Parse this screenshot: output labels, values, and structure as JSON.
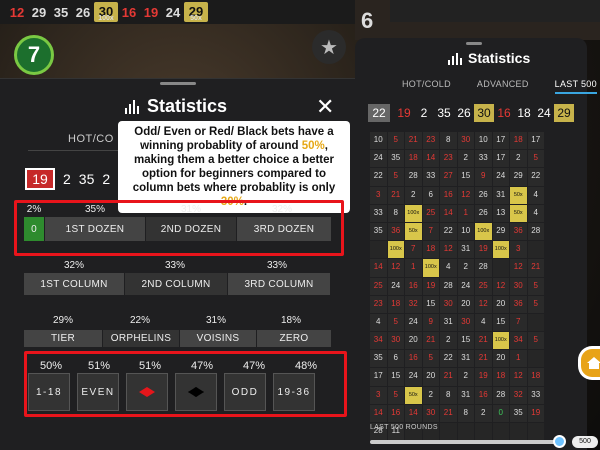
{
  "top_strip": {
    "numbers": [
      "12",
      "29",
      "35",
      "26",
      "30",
      "100x",
      "16",
      "19",
      "24",
      "29",
      "50x"
    ],
    "big_number": "7"
  },
  "right_top": {
    "number": "6"
  },
  "left_panel": {
    "title": "Statistics",
    "tab": "HOT/CO",
    "recent_numbers": [
      "19",
      "2",
      "35",
      "2"
    ],
    "annotation": {
      "pre": "Odd/ Even or Red/ Black bets have a winning probablity of around ",
      "hl1": "50%",
      "mid": ", making them a better choice a better option for beginners compared to column bets where probablity is only ",
      "hl2": "30%",
      "post": "."
    },
    "dozens": {
      "pcts": [
        "2%",
        "35%",
        "31%",
        "32%"
      ],
      "labels": [
        "0",
        "1ST DOZEN",
        "2ND DOZEN",
        "3RD DOZEN"
      ]
    },
    "columns": {
      "pcts": [
        "32%",
        "33%",
        "33%"
      ],
      "labels": [
        "1ST COLUMN",
        "2ND COLUMN",
        "3RD COLUMN"
      ]
    },
    "sectors": {
      "pcts": [
        "29%",
        "22%",
        "31%",
        "18%"
      ],
      "labels": [
        "TIER",
        "ORPHELINS",
        "VOISINS",
        "ZERO"
      ]
    },
    "even_bets": {
      "pcts": [
        "50%",
        "51%",
        "51%",
        "47%",
        "47%",
        "48%"
      ],
      "labels": [
        "1-18",
        "EVEN",
        "",
        "",
        "ODD",
        "19-36"
      ]
    }
  },
  "right_panel": {
    "title": "Statistics",
    "tabs": [
      "HOT/COLD",
      "ADVANCED",
      "LAST 500"
    ],
    "recent": [
      "22",
      "19",
      "2",
      "35",
      "26",
      "30",
      "16",
      "18",
      "24",
      "29"
    ],
    "recent_mult": [
      "100x",
      "50x"
    ],
    "rounds_label": "LAST 500 ROUNDS",
    "slider_value": "500",
    "grid": [
      [
        "10",
        "5",
        "21",
        "23",
        "8",
        "30",
        "10",
        "17",
        "18",
        "17"
      ],
      [
        "24",
        "35",
        "18",
        "14",
        "23",
        "2",
        "33",
        "17",
        "2",
        "5"
      ],
      [
        "22",
        "5",
        "28",
        "33",
        "27",
        "15",
        "9",
        "24",
        "29",
        "22"
      ],
      [
        "3",
        "21",
        "2",
        "6",
        "16",
        "12",
        "26",
        "31",
        "50x",
        "4"
      ],
      [
        "33",
        "8",
        "100x",
        "25",
        "14",
        "1",
        "26",
        "13",
        "50x",
        "4"
      ],
      [
        "35",
        "36",
        "50x",
        "7",
        "22",
        "10",
        "100x",
        "29",
        "36",
        "28"
      ],
      [
        "",
        "100x",
        "7",
        "18",
        "12",
        "31",
        "19",
        "100x",
        "3",
        ""
      ],
      [
        "14",
        "12",
        "1",
        "100x",
        "4",
        "2",
        "28",
        "",
        "12",
        "21"
      ],
      [
        "25",
        "24",
        "16",
        "19",
        "28",
        "24",
        "25",
        "12",
        "30",
        "5"
      ],
      [
        "23",
        "18",
        "32",
        "15",
        "30",
        "20",
        "12",
        "20",
        "36",
        "5"
      ],
      [
        "4",
        "5",
        "24",
        "9",
        "31",
        "30",
        "4",
        "15",
        "7",
        ""
      ],
      [
        "34",
        "30",
        "20",
        "21",
        "2",
        "15",
        "21",
        "100x",
        "34",
        "5"
      ],
      [
        "35",
        "6",
        "16",
        "5",
        "22",
        "31",
        "21",
        "20",
        "1",
        ""
      ],
      [
        "17",
        "15",
        "24",
        "20",
        "21",
        "2",
        "19",
        "18",
        "12",
        "18"
      ],
      [
        "3",
        "5",
        "50x",
        "2",
        "8",
        "31",
        "16",
        "28",
        "32",
        "33"
      ],
      [
        "14",
        "16",
        "14",
        "30",
        "21",
        "8",
        "2",
        "0",
        "35",
        "19"
      ],
      [
        "28",
        "11",
        "",
        "",
        "",
        "",
        "",
        "",
        "",
        ""
      ]
    ]
  }
}
